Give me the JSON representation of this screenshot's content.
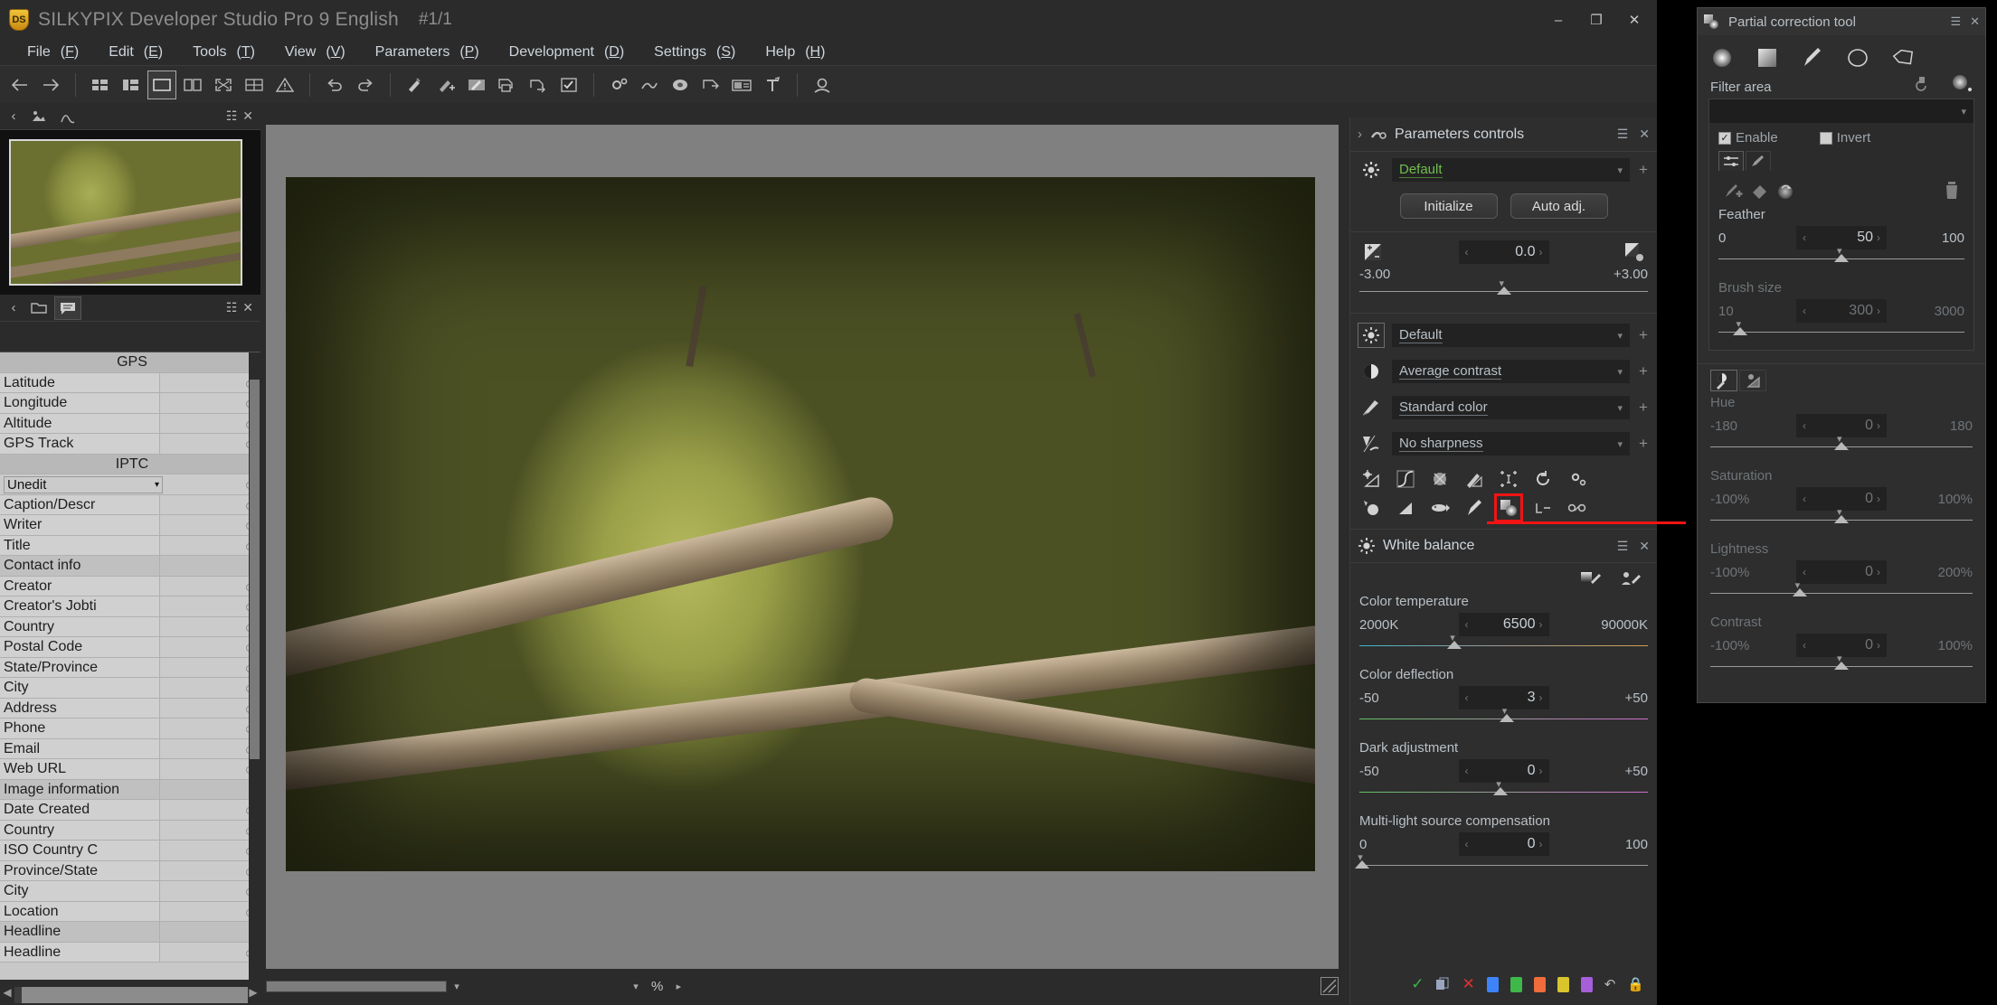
{
  "window": {
    "title": "SILKYPIX Developer Studio Pro 9 English",
    "index": "#1/1",
    "logo_text": "DS",
    "controls": {
      "minimize": "–",
      "maximize": "❐",
      "close": "✕"
    }
  },
  "menubar": [
    {
      "label": "File",
      "accel": "F"
    },
    {
      "label": "Edit",
      "accel": "E"
    },
    {
      "label": "Tools",
      "accel": "T"
    },
    {
      "label": "View",
      "accel": "V"
    },
    {
      "label": "Parameters",
      "accel": "P"
    },
    {
      "label": "Development",
      "accel": "D"
    },
    {
      "label": "Settings",
      "accel": "S"
    },
    {
      "label": "Help",
      "accel": "H"
    }
  ],
  "toolbar": {
    "items": [
      {
        "name": "back-icon"
      },
      {
        "name": "forward-icon"
      },
      {
        "name": "thumbnail-grid-icon"
      },
      {
        "name": "thumbnail-list-icon"
      },
      {
        "name": "single-view-icon"
      },
      {
        "name": "split-view-icon"
      },
      {
        "name": "fullscreen-icon"
      },
      {
        "name": "compare-grid-icon"
      },
      {
        "name": "warning-icon"
      },
      {
        "name": "undo-icon"
      },
      {
        "name": "redo-icon"
      },
      {
        "name": "taste-copy-icon"
      },
      {
        "name": "taste-paste-icon"
      },
      {
        "name": "taste-edit-icon"
      },
      {
        "name": "print-icon"
      },
      {
        "name": "export-icon"
      },
      {
        "name": "checkmark-box-icon"
      },
      {
        "name": "settings-gear-icon"
      },
      {
        "name": "noise-icon"
      },
      {
        "name": "lens-icon"
      },
      {
        "name": "share-icon"
      },
      {
        "name": "batch-icon"
      },
      {
        "name": "text-icon"
      },
      {
        "name": "face-icon"
      }
    ]
  },
  "left_panel": {
    "tabs_row1": [
      "folder-icon",
      "comment-icon"
    ],
    "metadata": {
      "sections": [
        {
          "title": "GPS",
          "rows": [
            {
              "key": "Latitude",
              "value": ""
            },
            {
              "key": "Longitude",
              "value": ""
            },
            {
              "key": "Altitude",
              "value": ""
            },
            {
              "key": "GPS Track",
              "value": ""
            }
          ]
        },
        {
          "title": "IPTC",
          "rows": [
            {
              "key": "Unedit",
              "value": "",
              "type": "combo"
            },
            {
              "key": "Caption/Descr",
              "value": ""
            },
            {
              "key": "Writer",
              "value": ""
            },
            {
              "key": "Title",
              "value": ""
            },
            {
              "key": "Contact info",
              "value": "",
              "type": "sub"
            },
            {
              "key": "Creator",
              "value": ""
            },
            {
              "key": "Creator's Jobti",
              "value": ""
            },
            {
              "key": "Country",
              "value": ""
            },
            {
              "key": "Postal Code",
              "value": ""
            },
            {
              "key": "State/Province",
              "value": ""
            },
            {
              "key": "City",
              "value": ""
            },
            {
              "key": "Address",
              "value": ""
            },
            {
              "key": "Phone",
              "value": ""
            },
            {
              "key": "Email",
              "value": ""
            },
            {
              "key": "Web URL",
              "value": ""
            },
            {
              "key": "Image information",
              "value": "",
              "type": "sub"
            },
            {
              "key": "Date Created",
              "value": ""
            },
            {
              "key": "Country",
              "value": ""
            },
            {
              "key": "ISO Country C",
              "value": ""
            },
            {
              "key": "Province/State",
              "value": ""
            },
            {
              "key": "City",
              "value": ""
            },
            {
              "key": "Location",
              "value": ""
            },
            {
              "key": "Headline",
              "value": "",
              "type": "sub"
            },
            {
              "key": "Headline",
              "value": ""
            }
          ]
        }
      ]
    }
  },
  "center": {
    "zoom_percent_label": "%"
  },
  "parameters_panel": {
    "title": "Parameters controls",
    "taste": {
      "value": "Default"
    },
    "buttons": {
      "initialize": "Initialize",
      "auto_adjust": "Auto adj."
    },
    "exposure": {
      "value": "0.0",
      "min": "-3.00",
      "max": "+3.00"
    },
    "selects": [
      {
        "icon": "tone-icon",
        "value": "Default"
      },
      {
        "icon": "contrast-icon",
        "value": "Average contrast"
      },
      {
        "icon": "color-icon",
        "value": "Standard color"
      },
      {
        "icon": "sharpness-icon",
        "value": "No sharpness"
      }
    ],
    "tool_icons_row1": [
      "exposure-bias-icon",
      "tone-curve-icon",
      "noise-reduction-icon",
      "color-adjust-icon",
      "crop-icon",
      "rotate-icon",
      "settings-gear-icon"
    ],
    "tool_icons_row2": [
      "dodge-burn-icon",
      "gradation-icon",
      "lens-aberration-icon",
      "brush-icon",
      "partial-correction-icon",
      "perspective-icon",
      "clone-stamp-icon"
    ],
    "white_balance": {
      "title": "White balance",
      "pickers": [
        "gray-picker-icon",
        "skin-picker-icon"
      ],
      "sliders": [
        {
          "label": "Color temperature",
          "value": "6500",
          "min": "2000K",
          "max": "90000K",
          "knob_pct": 33,
          "track": "temp"
        },
        {
          "label": "Color deflection",
          "value": "3",
          "min": "-50",
          "max": "+50",
          "knob_pct": 51,
          "track": "magenta"
        },
        {
          "label": "Dark adjustment",
          "value": "0",
          "min": "-50",
          "max": "+50",
          "knob_pct": 49,
          "track": "magenta"
        },
        {
          "label": "Multi-light source compensation",
          "value": "0",
          "min": "0",
          "max": "100",
          "knob_pct": 1,
          "track": "plain"
        }
      ]
    },
    "status_icons": [
      "check-icon",
      "copy-icon",
      "close-icon",
      "marker-blue-icon",
      "marker-green-icon",
      "marker-orange-icon",
      "marker-yellow-icon",
      "marker-purple-icon",
      "undo-icon",
      "lock-icon"
    ]
  },
  "partial_correction": {
    "title": "Partial correction tool",
    "shape_tools": [
      "radial-gradient-icon",
      "linear-gradient-icon",
      "brush-icon",
      "ellipse-icon",
      "polygon-icon"
    ],
    "action_icons": [
      "reset-area-icon",
      "show-area-icon"
    ],
    "filter_area_label": "Filter area",
    "filter_area_value": "",
    "enable": {
      "label": "Enable",
      "checked": true
    },
    "invert": {
      "label": "Invert",
      "checked": false
    },
    "subtabs": [
      "sliders-icon",
      "brush-settings-icon"
    ],
    "brush_actions": [
      "brush-add-icon",
      "eraser-icon",
      "invert-mask-icon"
    ],
    "trash_icon": "trash-icon",
    "sliders_top": [
      {
        "label": "Feather",
        "value": "50",
        "min": "0",
        "max": "100",
        "knob_pct": 50,
        "dim": false
      },
      {
        "label": "Brush size",
        "value": "300",
        "min": "10",
        "max": "3000",
        "knob_pct": 9,
        "dim": true
      }
    ],
    "tabs2": [
      "color-adjust-icon",
      "tone-adjust-icon"
    ],
    "sliders_bottom": [
      {
        "label": "Hue",
        "value": "0",
        "min": "-180",
        "max": "180",
        "knob_pct": 50
      },
      {
        "label": "Saturation",
        "value": "0",
        "min": "-100%",
        "max": "100%",
        "knob_pct": 50
      },
      {
        "label": "Lightness",
        "value": "0",
        "min": "-100%",
        "max": "200%",
        "knob_pct": 34
      },
      {
        "label": "Contrast",
        "value": "0",
        "min": "-100%",
        "max": "100%",
        "knob_pct": 50
      }
    ]
  },
  "colors": {
    "accent_red": "#f01414",
    "green_text": "#6fbf4e",
    "panel_bg": "#2e2e2e",
    "metadata_bg": "#c8c8c8"
  }
}
